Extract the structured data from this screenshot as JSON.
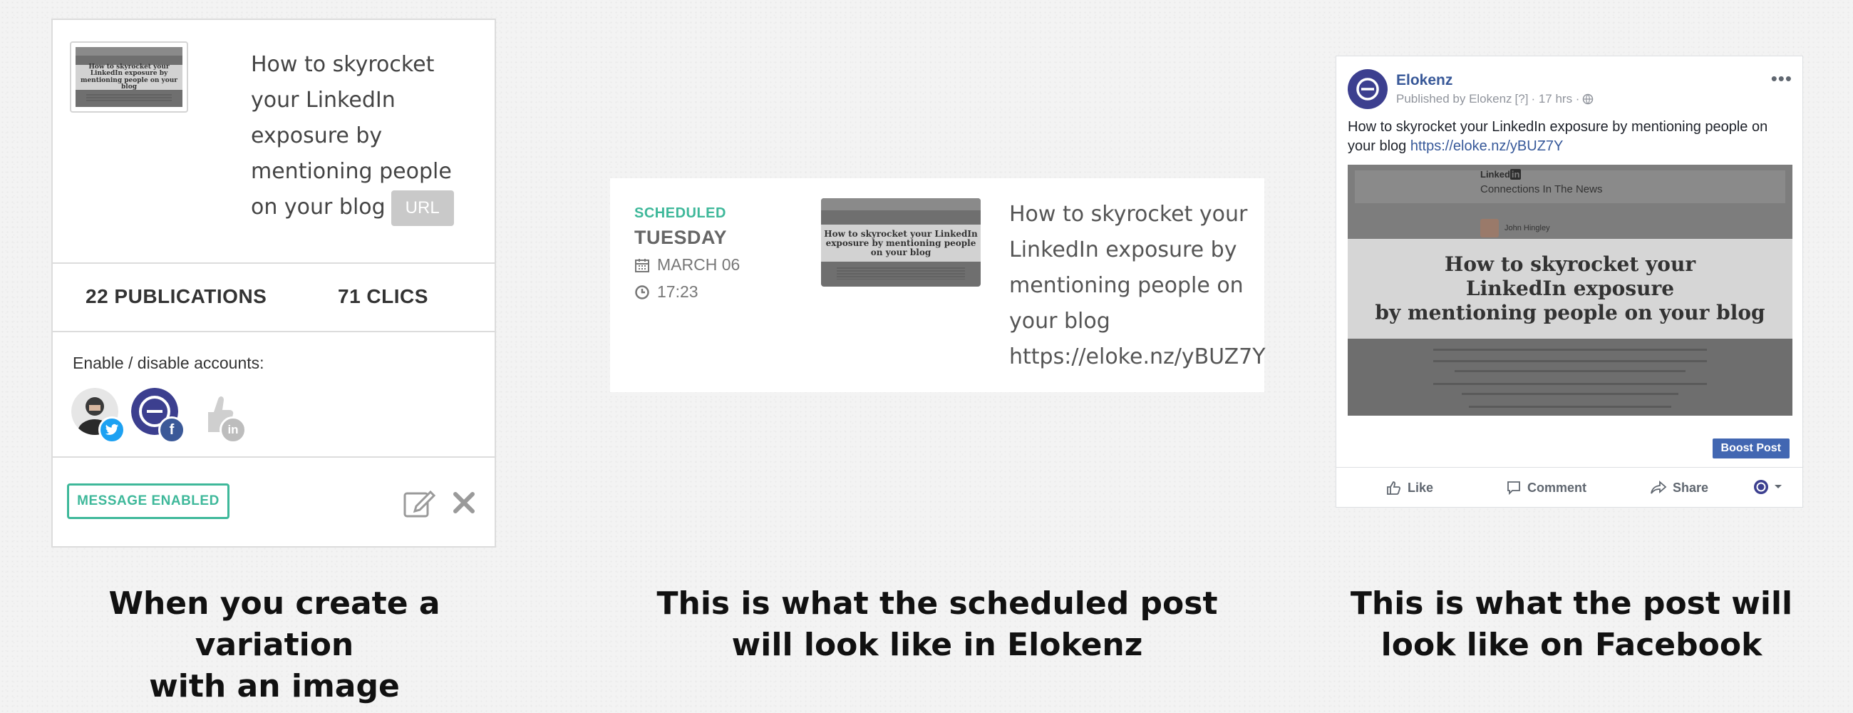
{
  "variation_card": {
    "title": "How to skyrocket your LinkedIn exposure by mentioning people on your blog",
    "url_badge": "URL",
    "thumbnail_text": "How to skyrocket your LinkedIn exposure by mentioning people on your blog",
    "publications": "22 PUBLICATIONS",
    "clics": "71 CLICS",
    "enable_label": "Enable / disable accounts:",
    "accounts": [
      {
        "name": "twitter",
        "icon": "twitter-icon",
        "color": "#1da1f2"
      },
      {
        "name": "facebook",
        "icon": "facebook-icon",
        "color": "#3b5998"
      },
      {
        "name": "linkedin",
        "icon": "linkedin-icon",
        "color": "#bdbdbd"
      }
    ],
    "message_button": "MESSAGE ENABLED",
    "edit_icon": "edit-icon",
    "delete_icon": "close-icon"
  },
  "scheduled_card": {
    "status": "SCHEDULED",
    "day": "TUESDAY",
    "date": "MARCH 06",
    "time": "17:23",
    "calendar_icon": "calendar-icon",
    "clock_icon": "clock-icon",
    "text_line": "How to skyrocket your LinkedIn exposure by mentioning people on your blog",
    "url": "https://eloke.nz/yBUZ7Y",
    "thumbnail_text": "How to skyrocket your LinkedIn exposure by mentioning people on your blog"
  },
  "facebook_post": {
    "page_name": "Elokenz",
    "meta_published": "Published by Elokenz",
    "meta_help": "[?]",
    "meta_time": "· 17 hrs ·",
    "text": "How to skyrocket your LinkedIn exposure by mentioning people on your blog",
    "link": "https://eloke.nz/yBUZ7Y",
    "image_brand": "Linked",
    "image_brand_in": "in",
    "image_subtitle": "Connections In The News",
    "image_person": "John Hingley",
    "image_headline_1": "How to skyrocket your",
    "image_headline_2": "LinkedIn exposure",
    "image_headline_3": "by mentioning people on your blog",
    "boost_button": "Boost Post",
    "actions": {
      "like": "Like",
      "comment": "Comment",
      "share": "Share"
    },
    "colors": {
      "link": "#365899",
      "brand": "#4267b2"
    }
  },
  "captions": {
    "left_1": "When you create a variation",
    "left_2": "with an image",
    "middle_1": "This is what the scheduled post",
    "middle_2": "will look like in Elokenz",
    "right_1": "This is what the post will",
    "right_2": "look like on Facebook"
  },
  "accent_color": "#3eb89a"
}
